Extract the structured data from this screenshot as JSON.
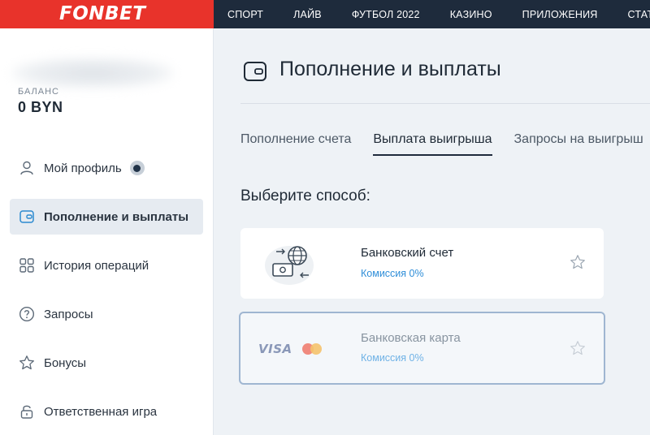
{
  "header": {
    "logo": "FONBET",
    "nav": [
      "СПОРТ",
      "ЛАЙВ",
      "ФУТБОЛ 2022",
      "КАЗИНО",
      "ПРИЛОЖЕНИЯ",
      "СТАТИСТИ"
    ]
  },
  "sidebar": {
    "balance_label": "БАЛАНС",
    "balance_value": "0 BYN",
    "items": [
      {
        "label": "Мой профиль",
        "icon": "user-icon"
      },
      {
        "label": "Пополнение и выплаты",
        "icon": "wallet-icon",
        "active": true
      },
      {
        "label": "История операций",
        "icon": "grid-icon"
      },
      {
        "label": "Запросы",
        "icon": "question-icon"
      },
      {
        "label": "Бонусы",
        "icon": "star-icon"
      },
      {
        "label": "Ответственная игра",
        "icon": "lock-icon"
      }
    ]
  },
  "main": {
    "title": "Пополнение и выплаты",
    "tabs": [
      "Пополнение счета",
      "Выплата выигрыша",
      "Запросы на выигрыш"
    ],
    "active_tab": "Выплата выигрыша",
    "choose_label": "Выберите способ:",
    "methods": [
      {
        "name": "Банковский счет",
        "fee": "Комиссия 0%",
        "icon": "bank-transfer-icon"
      },
      {
        "name": "Банковская карта",
        "fee": "Комиссия 0%",
        "icon": "visa-mastercard-icon",
        "brand_text": "VISA"
      }
    ]
  },
  "colors": {
    "topbar": "#1e2b3c",
    "logo_bg": "#e8332b",
    "accent_blue": "#2f8ed8"
  }
}
